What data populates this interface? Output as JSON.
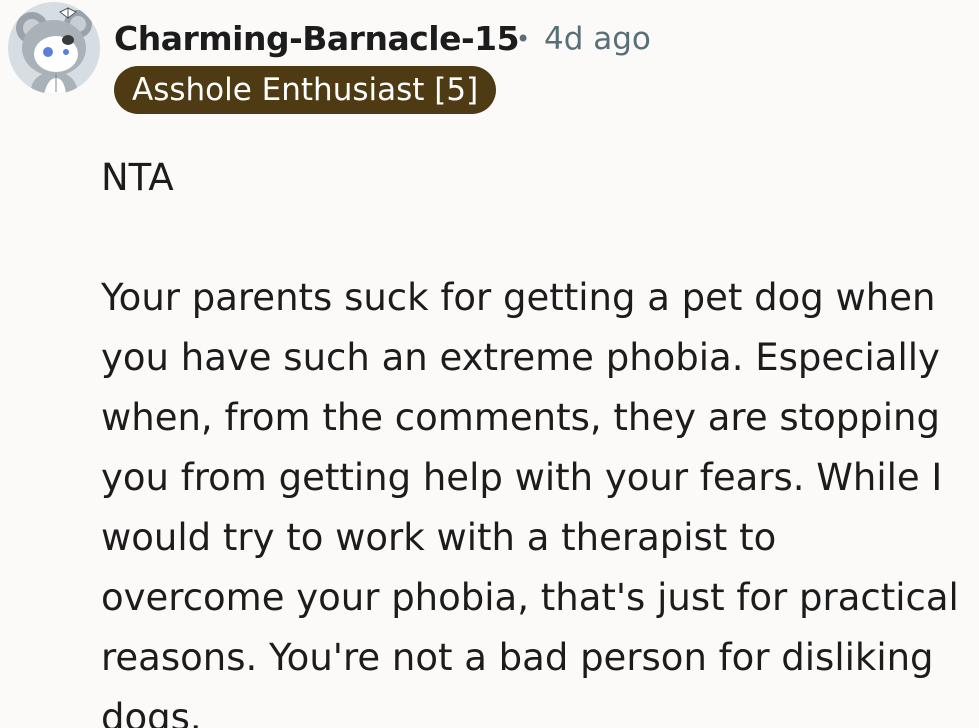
{
  "comment": {
    "author": "Charming-Barnacle-15",
    "separator": "•",
    "timestamp": "4d ago",
    "flair": "Asshole Enthusiast [5]",
    "paragraphs": [
      "NTA",
      "Your parents suck for getting a pet dog when you have such an extreme phobia. Especially when, from the comments, they are stopping you from getting help with your fears. While I would try to work with a therapist to overcome your phobia, that's just for practical reasons. You're not a bad person for disliking dogs."
    ]
  },
  "colors": {
    "background": "#fcfaf9",
    "text": "#1c1c1c",
    "meta": "#576f76",
    "flair_bg": "#4f3b13",
    "flair_text": "#ffffff"
  },
  "icons": {
    "avatar": "snoo-avatar-koala-costume"
  }
}
